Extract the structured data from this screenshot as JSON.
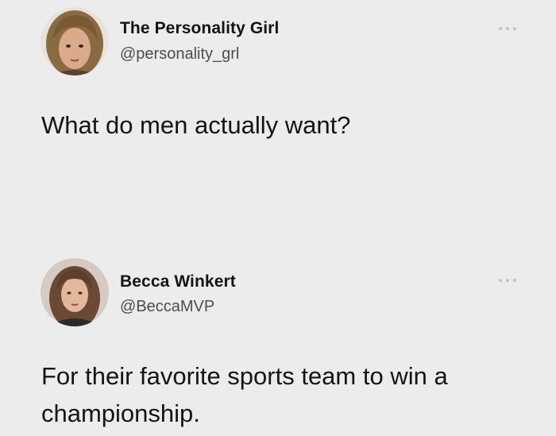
{
  "tweets": [
    {
      "display_name": "The Personality Girl",
      "handle": "@personality_grl",
      "text": "What do men actually want?",
      "avatar_icon": "profile-photo"
    },
    {
      "display_name": "Becca Winkert",
      "handle": "@BeccaMVP",
      "text": "For their favorite sports team to win a championship.",
      "avatar_icon": "profile-photo"
    }
  ],
  "more_icon": "more-options-icon",
  "colors": {
    "background": "#ececec",
    "text": "#141414",
    "handle": "#4d4d4d",
    "dots": "#c4c4c4"
  }
}
